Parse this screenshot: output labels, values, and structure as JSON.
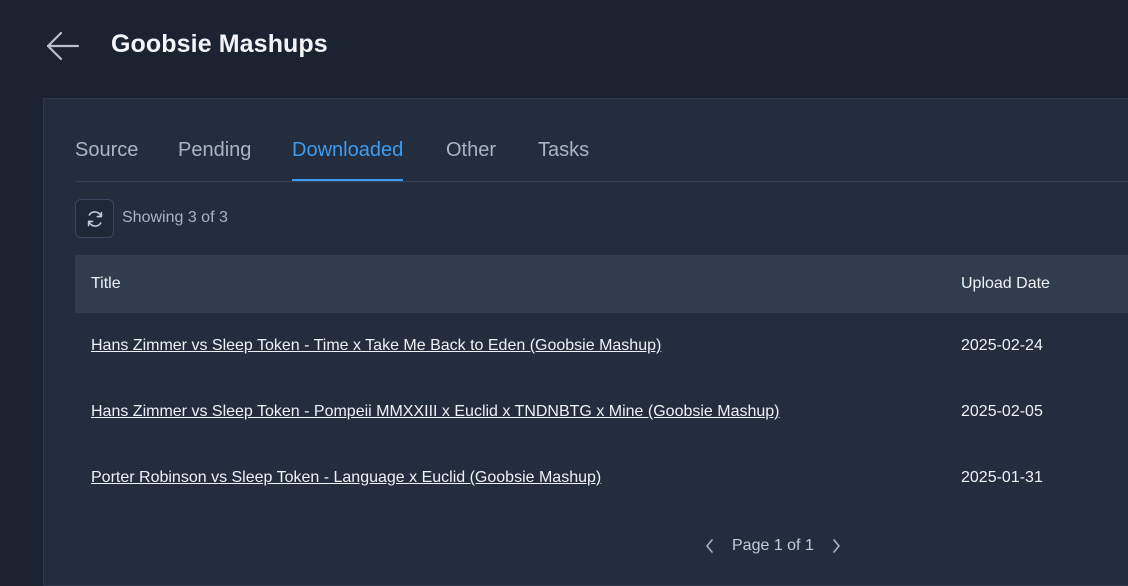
{
  "header": {
    "title": "Goobsie Mashups",
    "back_icon": "arrow-left-icon"
  },
  "tabs": [
    {
      "label": "Source",
      "active": false
    },
    {
      "label": "Pending",
      "active": false
    },
    {
      "label": "Downloaded",
      "active": true
    },
    {
      "label": "Other",
      "active": false
    },
    {
      "label": "Tasks",
      "active": false
    }
  ],
  "toolbar": {
    "refresh_icon": "refresh-icon",
    "showing_text": "Showing 3 of 3"
  },
  "table": {
    "columns": [
      "Title",
      "Upload Date"
    ],
    "rows": [
      {
        "title": "Hans Zimmer vs Sleep Token - Time x Take Me Back to Eden (Goobsie Mashup)",
        "date": "2025-02-24"
      },
      {
        "title": "Hans Zimmer vs Sleep Token - Pompeii MMXXIII x Euclid x TNDNBTG x Mine (Goobsie Mashup)",
        "date": "2025-02-05"
      },
      {
        "title": "Porter Robinson vs Sleep Token - Language x Euclid (Goobsie Mashup)",
        "date": "2025-01-31"
      }
    ]
  },
  "pagination": {
    "text": "Page 1 of 1",
    "prev_icon": "chevron-left-icon",
    "next_icon": "chevron-right-icon"
  },
  "colors": {
    "accent": "#3d9cf0",
    "background": "#1c2330",
    "panel": "#232d3d",
    "table_header": "#313d4e"
  }
}
